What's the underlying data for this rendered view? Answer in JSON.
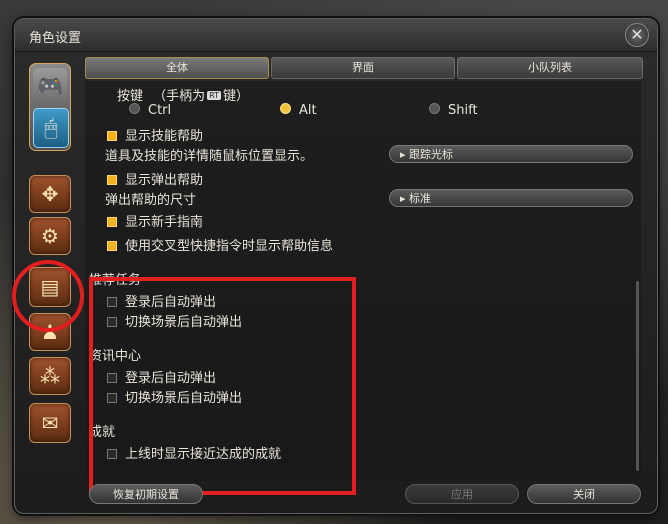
{
  "window": {
    "title": "角色设置",
    "close_icon": "close-icon"
  },
  "tabs": [
    {
      "label": "全体",
      "active": true
    },
    {
      "label": "界面",
      "active": false
    },
    {
      "label": "小队列表",
      "active": false
    }
  ],
  "keybind": {
    "label": "按键",
    "hint_prefix": "（手柄为",
    "rt_badge": "RT",
    "hint_suffix": "键）",
    "options": [
      "Ctrl",
      "Alt",
      "Shift"
    ],
    "selected": "Alt"
  },
  "settings": {
    "skill_help": "显示技能帮助",
    "item_skill_detail": "道具及技能的详情随鼠标位置显示。",
    "item_skill_dropdown": "跟踪光标",
    "popup_help": "显示弹出帮助",
    "popup_size_label": "弹出帮助的尺寸",
    "popup_size_dropdown": "标准",
    "newbie_guide": "显示新手指南",
    "cross_hotbar_help": "使用交叉型快捷指令时显示帮助信息"
  },
  "recommended": {
    "title": "推荐任务",
    "auto_popup_login": "登录后自动弹出",
    "auto_popup_zone": "切换场景后自动弹出"
  },
  "news": {
    "title": "资讯中心",
    "auto_popup_login": "登录后自动弹出",
    "auto_popup_zone": "切换场景后自动弹出"
  },
  "achievement": {
    "title": "成就",
    "near_complete": "上线时显示接近达成的成就"
  },
  "footer": {
    "reset": "恢复初期设置",
    "apply": "应用",
    "close": "关闭"
  },
  "colors": {
    "accent": "#f1b21f",
    "highlight_red": "#e21e1e"
  }
}
